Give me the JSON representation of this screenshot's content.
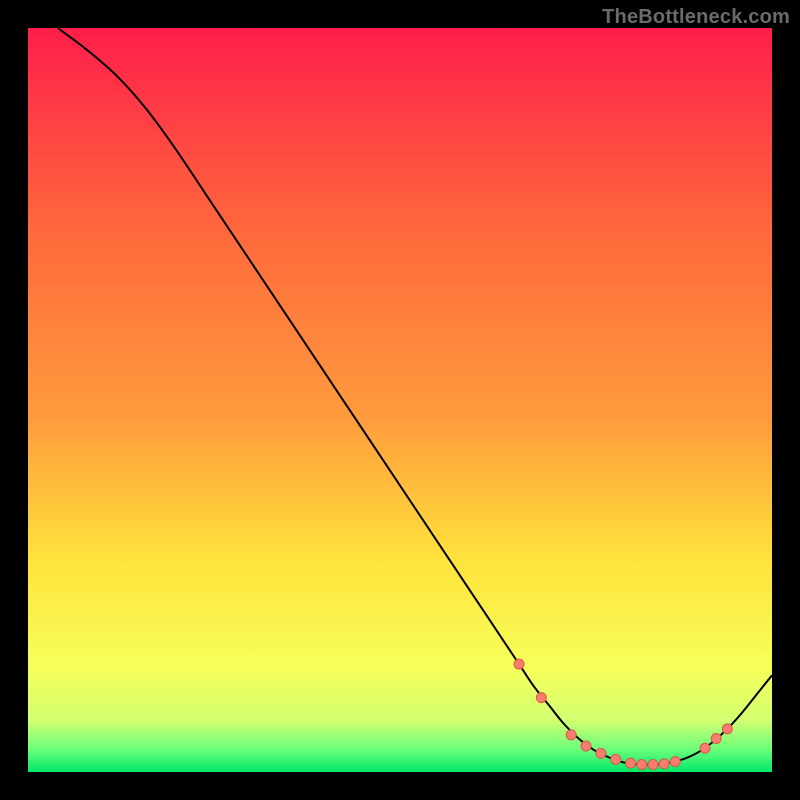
{
  "watermark": "TheBottleneck.com",
  "chart_data": {
    "type": "line",
    "title": "",
    "xlabel": "",
    "ylabel": "",
    "xlim": [
      0,
      100
    ],
    "ylim": [
      0,
      100
    ],
    "grid": false,
    "legend": false,
    "background_gradient": {
      "top": "#ff1e4b",
      "upper_mid": "#ff9a3c",
      "mid": "#ffe43c",
      "lower_mid": "#f6ff5a",
      "low": "#d3ff70",
      "bottom": "#00e86a"
    },
    "series": [
      {
        "name": "curve",
        "color": "#000000",
        "stroke_width": 2,
        "x": [
          4,
          8,
          12,
          16,
          20,
          24,
          28,
          32,
          36,
          40,
          44,
          48,
          52,
          56,
          60,
          64,
          66,
          68,
          70,
          72,
          74,
          76,
          78,
          80,
          82,
          84,
          86,
          88,
          90,
          92,
          94,
          96,
          98,
          100
        ],
        "y": [
          100,
          97,
          93.5,
          89,
          83.5,
          77.5,
          71.5,
          65.5,
          59.5,
          53.5,
          47.5,
          41.5,
          35.5,
          29.5,
          23.5,
          17.5,
          14.5,
          11.5,
          9,
          6.5,
          4.5,
          3,
          2,
          1.3,
          1,
          1,
          1.2,
          1.7,
          2.6,
          4,
          5.8,
          8,
          10.5,
          13
        ]
      }
    ],
    "markers": {
      "name": "dots",
      "shape": "circle",
      "radius": 5,
      "fill": "#f77d6e",
      "stroke": "#d85a4a",
      "points": [
        {
          "x": 66,
          "y": 14.5
        },
        {
          "x": 69,
          "y": 10
        },
        {
          "x": 73,
          "y": 5
        },
        {
          "x": 75,
          "y": 3.5
        },
        {
          "x": 77,
          "y": 2.5
        },
        {
          "x": 79,
          "y": 1.7
        },
        {
          "x": 81,
          "y": 1.2
        },
        {
          "x": 82.5,
          "y": 1
        },
        {
          "x": 84,
          "y": 1
        },
        {
          "x": 85.5,
          "y": 1.1
        },
        {
          "x": 87,
          "y": 1.4
        },
        {
          "x": 91,
          "y": 3.2
        },
        {
          "x": 92.5,
          "y": 4.5
        },
        {
          "x": 94,
          "y": 5.8
        }
      ]
    }
  }
}
